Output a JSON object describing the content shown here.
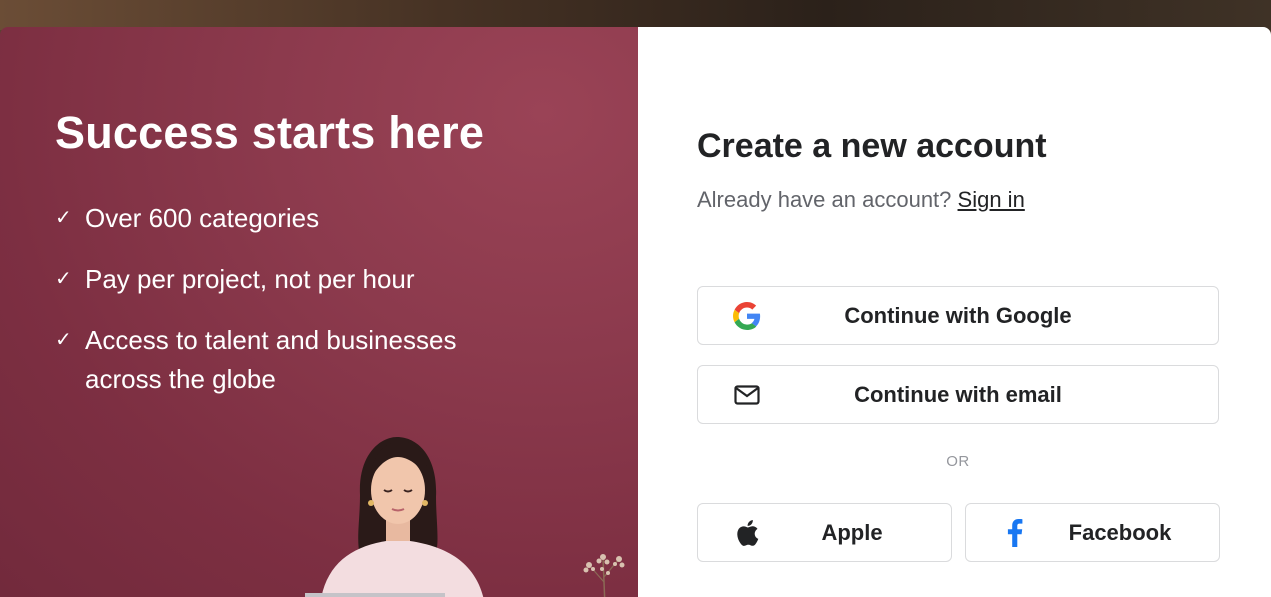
{
  "promo": {
    "heading": "Success starts here",
    "features": [
      "Over 600 categories",
      "Pay per project, not per hour",
      "Access to talent and businesses across the globe"
    ],
    "check_glyph": "✓",
    "background_color": "#8c3a4d"
  },
  "signup": {
    "title": "Create a new account",
    "already_text": "Already have an account?",
    "signin_link": "Sign in",
    "or_separator": "OR",
    "buttons": {
      "google": {
        "label": "Continue with Google",
        "icon": "google-icon"
      },
      "email": {
        "label": "Continue with email",
        "icon": "envelope-icon"
      },
      "apple": {
        "label": "Apple",
        "icon": "apple-icon"
      },
      "facebook": {
        "label": "Facebook",
        "icon": "facebook-icon"
      }
    },
    "colors": {
      "text": "#222325",
      "muted": "#62646a",
      "border": "#dadbdd",
      "facebook_blue": "#1877f2"
    }
  }
}
